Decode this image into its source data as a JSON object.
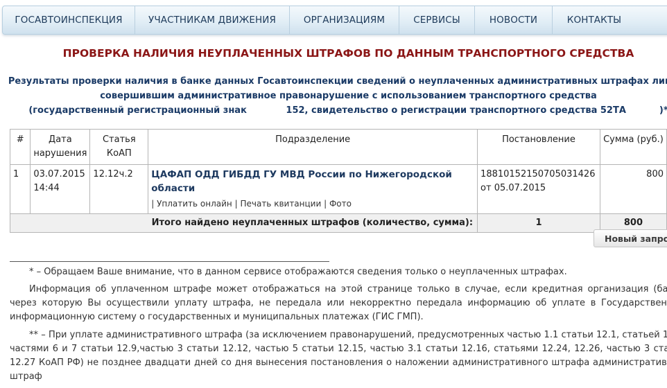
{
  "nav": {
    "items": [
      {
        "label": "ГОСАВТОИНСПЕКЦИЯ"
      },
      {
        "label": "УЧАСТНИКАМ ДВИЖЕНИЯ"
      },
      {
        "label": "ОРГАНИЗАЦИЯМ"
      },
      {
        "label": "СЕРВИСЫ"
      },
      {
        "label": "НОВОСТИ"
      },
      {
        "label": "КОНТАКТЫ"
      }
    ]
  },
  "page_title": "ПРОВЕРКА НАЛИЧИЯ НЕУПЛАЧЕННЫХ ШТРАФОВ ПО ДАННЫМ ТРАНСПОРТНОГО СРЕДСТВА",
  "results": {
    "line1": "Результаты проверки наличия в банке данных Госавтоинспекции сведений о неуплаченных административных штрафах лицом,",
    "line2": "совершившим административное правонарушение с использованием транспортного средства",
    "line3_a": "(государственный регистрационный знак ",
    "line3_b": "152, свидетельство о регистрации транспортного средства 52ТА",
    "line3_c": ")*"
  },
  "table": {
    "headers": {
      "num": "#",
      "date": "Дата нарушения",
      "article": "Статья КоАП",
      "department": "Подразделение",
      "decision": "Постановление",
      "sum": "Сумма (руб.)"
    },
    "rows": [
      {
        "num": "1",
        "date": "03.07.2015 14:44",
        "article": "12.12ч.2",
        "department": "ЦАФАП ОДД ГИБДД ГУ МВД России по Нижегородской области",
        "link_pay": "| Уплатить онлайн",
        "link_print": "| Печать квитанции",
        "link_photo": "| Фото",
        "decision_number": "18810152150705031426",
        "decision_date": "от 05.07.2015",
        "sum": "800"
      }
    ],
    "total": {
      "label": "Итого найдено неуплаченных штрафов (количество, сумма):",
      "count": "1",
      "sum": "800"
    }
  },
  "new_request_label": "Новый запрос",
  "notes": {
    "n1": "* – Обращаем Ваше внимание, что в данном сервисе отображаются сведения только о неуплаченных штрафах.",
    "n2": "Информация об уплаченном штрафе может отображаться на этой странице только в случае, если кредитная организация (банк), через которую Вы осуществили уплату штрафа, не передала или некорректно передала информацию об уплате в Государственную информационную систему о государственных и муниципальных платежах (ГИС ГМП).",
    "n3": "** – При уплате административного штрафа (за исключением правонарушений, предусмотренных частью 1.1 статьи 12.1, статьей 12.8, частями 6 и 7 статьи 12.9,частью 3 статьи 12.12, частью 5 статьи 12.15, частью 3.1 статьи 12.16, статьями 12.24, 12.26, частью 3 статьи 12.27 КоАП РФ) не позднее двадцати дней со дня вынесения постановления о наложении административного штрафа административный штраф"
  }
}
